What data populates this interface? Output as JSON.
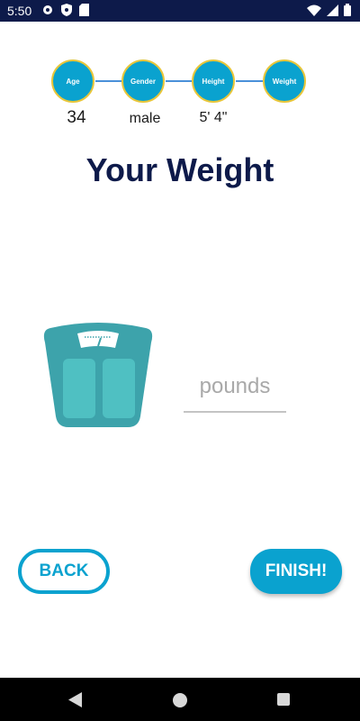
{
  "status_bar": {
    "time": "5:50",
    "icons": [
      "gear-icon",
      "shield-icon",
      "sd-card-icon",
      "wifi-icon",
      "signal-icon",
      "battery-icon"
    ]
  },
  "stepper": {
    "steps": [
      {
        "label": "Age",
        "value": "34"
      },
      {
        "label": "Gender",
        "value": "male"
      },
      {
        "label": "Height",
        "value": "5' 4\""
      },
      {
        "label": "Weight",
        "value": ""
      }
    ]
  },
  "page": {
    "title": "Your Weight"
  },
  "weight": {
    "placeholder": "pounds",
    "value": ""
  },
  "buttons": {
    "back_label": "BACK",
    "finish_label": "FINISH!"
  },
  "colors": {
    "accent": "#0aa2cf",
    "title": "#0d1a4a",
    "step_border": "#e8c63a",
    "status_bar": "#0d1a4a"
  }
}
